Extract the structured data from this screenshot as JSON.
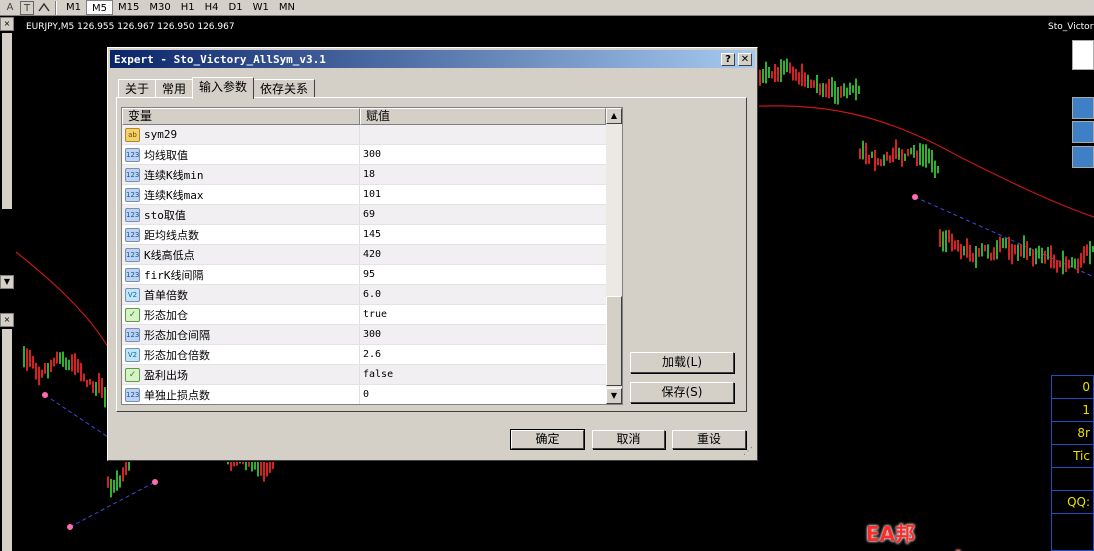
{
  "toolbar": {
    "icons": [
      "A",
      "T",
      "arrow-tool"
    ],
    "timeframes": [
      "M1",
      "M5",
      "M15",
      "M30",
      "H1",
      "H4",
      "D1",
      "W1",
      "MN"
    ],
    "active_timeframe": "M5"
  },
  "chart": {
    "symbol_label": "EURJPY,M5  126.955 126.967 126.950 126.967",
    "right_label": "Sto_Victory"
  },
  "right_panel": {
    "values": [
      "0",
      "1",
      "8r",
      "Tic",
      "",
      "QQ:",
      ""
    ]
  },
  "watermark": "EA邦 www.eabang.com",
  "dialog": {
    "title": "Expert - Sto_Victory_AllSym_v3.1",
    "help_label": "?",
    "close_label": "✕",
    "tabs": [
      "关于",
      "常用",
      "输入参数",
      "依存关系"
    ],
    "active_tab": "输入参数",
    "grid": {
      "col_variable": "变量",
      "col_value": "赋值",
      "rows": [
        {
          "type": "ab",
          "name": "sym29",
          "value": ""
        },
        {
          "type": "123",
          "name": "均线取值",
          "value": "300"
        },
        {
          "type": "123",
          "name": "连续K线min",
          "value": "18"
        },
        {
          "type": "123",
          "name": "连续K线max",
          "value": "101"
        },
        {
          "type": "123",
          "name": "sto取值",
          "value": "69"
        },
        {
          "type": "123",
          "name": "距均线点数",
          "value": "145"
        },
        {
          "type": "123",
          "name": "K线高低点",
          "value": "420"
        },
        {
          "type": "123",
          "name": "firK线间隔",
          "value": "95"
        },
        {
          "type": "v2",
          "name": "首单倍数",
          "value": "6.0"
        },
        {
          "type": "bool",
          "name": "形态加仓",
          "value": "true"
        },
        {
          "type": "123",
          "name": "形态加仓间隔",
          "value": "300"
        },
        {
          "type": "v2",
          "name": "形态加仓倍数",
          "value": "2.6"
        },
        {
          "type": "bool",
          "name": "盈利出场",
          "value": "false"
        },
        {
          "type": "123",
          "name": "单独止损点数",
          "value": "0"
        }
      ]
    },
    "load_label": "加载(L)",
    "save_label": "保存(S)",
    "ok_label": "确定",
    "cancel_label": "取消",
    "reset_label": "重设"
  }
}
